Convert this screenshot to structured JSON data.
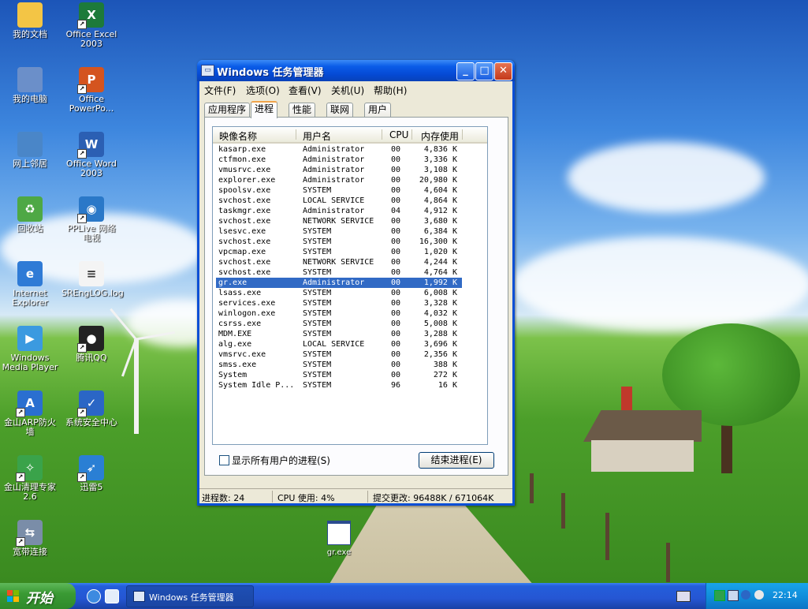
{
  "desktop": {
    "icons": [
      {
        "label": "我的文档",
        "icon": "folder-documents-icon",
        "color": "#f3c545",
        "glyph": "",
        "shortcut": false
      },
      {
        "label": "Office Excel\n2003",
        "icon": "excel-icon",
        "color": "#1d7a3a",
        "glyph": "X",
        "shortcut": true
      },
      {
        "label": "我的电脑",
        "icon": "my-computer-icon",
        "color": "#6b8fc9",
        "glyph": "",
        "shortcut": false
      },
      {
        "label": "Office\nPowerPo...",
        "icon": "powerpoint-icon",
        "color": "#d4541f",
        "glyph": "P",
        "shortcut": true
      },
      {
        "label": "网上邻居",
        "icon": "network-places-icon",
        "color": "#4a86c8",
        "glyph": "",
        "shortcut": false
      },
      {
        "label": "Office Word\n2003",
        "icon": "word-icon",
        "color": "#2b5fb3",
        "glyph": "W",
        "shortcut": true
      },
      {
        "label": "回收站",
        "icon": "recycle-bin-icon",
        "color": "#4ea845",
        "glyph": "♻",
        "shortcut": false
      },
      {
        "label": "PPLive 网络\n电视",
        "icon": "pplive-icon",
        "color": "#2a78c8",
        "glyph": "◉",
        "shortcut": true
      },
      {
        "label": "Internet\nExplorer",
        "icon": "internet-explorer-icon",
        "color": "#2f7bd6",
        "glyph": "e",
        "shortcut": false
      },
      {
        "label": "SREngLOG.log",
        "icon": "text-file-icon",
        "color": "#f4f4f4",
        "glyph": "≡",
        "shortcut": false
      },
      {
        "label": "Windows\nMedia Player",
        "icon": "media-player-icon",
        "color": "#3b9ae0",
        "glyph": "▶",
        "shortcut": false
      },
      {
        "label": "腾讯QQ",
        "icon": "qq-penguin-icon",
        "color": "#222222",
        "glyph": "●",
        "shortcut": true
      },
      {
        "label": "金山ARP防火\n墙",
        "icon": "arp-firewall-icon",
        "color": "#2a6fd0",
        "glyph": "A",
        "shortcut": true
      },
      {
        "label": "系统安全中心",
        "icon": "security-center-icon",
        "color": "#2b66c5",
        "glyph": "✓",
        "shortcut": true
      },
      {
        "label": "金山清理专家\n2.6",
        "icon": "cleaner-icon",
        "color": "#3aa34a",
        "glyph": "✧",
        "shortcut": true
      },
      {
        "label": "迅雷5",
        "icon": "thunder-icon",
        "color": "#2a7fd4",
        "glyph": "➶",
        "shortcut": true
      },
      {
        "label": "宽带连接",
        "icon": "broadband-connection-icon",
        "color": "#7a8da8",
        "glyph": "⇆",
        "shortcut": true
      }
    ],
    "file_label": "gr.exe"
  },
  "window": {
    "title": "Windows 任务管理器",
    "minimize": "_",
    "maximize": "□",
    "close": "✕",
    "menu": [
      "文件(F)",
      "选项(O)",
      "查看(V)",
      "关机(U)",
      "帮助(H)"
    ],
    "tabs": [
      "应用程序",
      "进程",
      "性能",
      "联网",
      "用户"
    ],
    "active_tab": 1,
    "columns": [
      "映像名称",
      "用户名",
      "CPU",
      "内存使用"
    ],
    "processes": [
      [
        "kasarp.exe",
        "Administrator",
        "00",
        "4,836 K"
      ],
      [
        "ctfmon.exe",
        "Administrator",
        "00",
        "3,336 K"
      ],
      [
        "vmusrvc.exe",
        "Administrator",
        "00",
        "3,108 K"
      ],
      [
        "explorer.exe",
        "Administrator",
        "00",
        "20,980 K"
      ],
      [
        "spoolsv.exe",
        "SYSTEM",
        "00",
        "4,604 K"
      ],
      [
        "svchost.exe",
        "LOCAL SERVICE",
        "00",
        "4,864 K"
      ],
      [
        "taskmgr.exe",
        "Administrator",
        "04",
        "4,912 K"
      ],
      [
        "svchost.exe",
        "NETWORK SERVICE",
        "00",
        "3,680 K"
      ],
      [
        "lsesvc.exe",
        "SYSTEM",
        "00",
        "6,384 K"
      ],
      [
        "svchost.exe",
        "SYSTEM",
        "00",
        "16,300 K"
      ],
      [
        "vpcmap.exe",
        "SYSTEM",
        "00",
        "1,020 K"
      ],
      [
        "svchost.exe",
        "NETWORK SERVICE",
        "00",
        "4,244 K"
      ],
      [
        "svchost.exe",
        "SYSTEM",
        "00",
        "4,764 K"
      ],
      [
        "gr.exe",
        "Administrator",
        "00",
        "1,992 K"
      ],
      [
        "lsass.exe",
        "SYSTEM",
        "00",
        "6,008 K"
      ],
      [
        "services.exe",
        "SYSTEM",
        "00",
        "3,328 K"
      ],
      [
        "winlogon.exe",
        "SYSTEM",
        "00",
        "4,032 K"
      ],
      [
        "csrss.exe",
        "SYSTEM",
        "00",
        "5,008 K"
      ],
      [
        "MDM.EXE",
        "SYSTEM",
        "00",
        "3,288 K"
      ],
      [
        "alg.exe",
        "LOCAL SERVICE",
        "00",
        "3,696 K"
      ],
      [
        "vmsrvc.exe",
        "SYSTEM",
        "00",
        "2,356 K"
      ],
      [
        "smss.exe",
        "SYSTEM",
        "00",
        "388 K"
      ],
      [
        "System",
        "SYSTEM",
        "00",
        "272 K"
      ],
      [
        "System Idle P...",
        "SYSTEM",
        "96",
        "16 K"
      ]
    ],
    "selected_row": 13,
    "show_all_users": "显示所有用户的进程(S)",
    "end_process": "结束进程(E)",
    "status": {
      "processes": "进程数: 24",
      "cpu": "CPU 使用: 4%",
      "commit": "提交更改: 96488K / 671064K"
    }
  },
  "taskbar": {
    "start_label": "开始",
    "task_label": "Windows 任务管理器",
    "clock": "22:14"
  }
}
